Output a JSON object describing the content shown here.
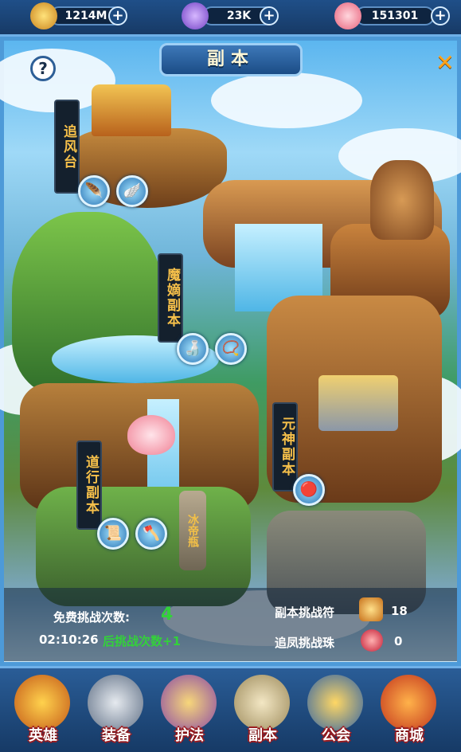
{
  "resources": {
    "gold": {
      "value": "1214M",
      "icon": "gold-ingot-icon"
    },
    "gem": {
      "value": "23K",
      "icon": "gem-icon"
    },
    "peach": {
      "value": "151301",
      "icon": "peach-icon"
    },
    "plus_label": "+"
  },
  "header": {
    "title": "副本",
    "help_label": "?",
    "close_label": "✕"
  },
  "dungeons": [
    {
      "name": "追风台",
      "rewards": [
        "feather-icon",
        "wing-icon"
      ]
    },
    {
      "name": "魔嫡副本",
      "rewards": [
        "gourd-icon",
        "bead-icon"
      ]
    },
    {
      "name": "元神副本",
      "rewards": [
        "spirit-orb-icon"
      ]
    },
    {
      "name": "道行副本",
      "rewards": [
        "scroll-icon",
        "axe-icon"
      ]
    }
  ],
  "map_sign": "冰帝瓶",
  "info": {
    "free_label": "免费挑战次数:",
    "free_count": "4",
    "timer": "02:10:26",
    "timer_suffix": "后挑战次数+1",
    "token1_label": "副本挑战符",
    "token1_count": "18",
    "token2_label": "追凤挑战珠",
    "token2_count": "0"
  },
  "nav": [
    {
      "label": "英雄",
      "icon": "hero-icon"
    },
    {
      "label": "装备",
      "icon": "equipment-icon"
    },
    {
      "label": "护法",
      "icon": "guardian-icon"
    },
    {
      "label": "副本",
      "icon": "dungeon-icon"
    },
    {
      "label": "公会",
      "icon": "guild-icon"
    },
    {
      "label": "商城",
      "icon": "shop-icon"
    }
  ]
}
